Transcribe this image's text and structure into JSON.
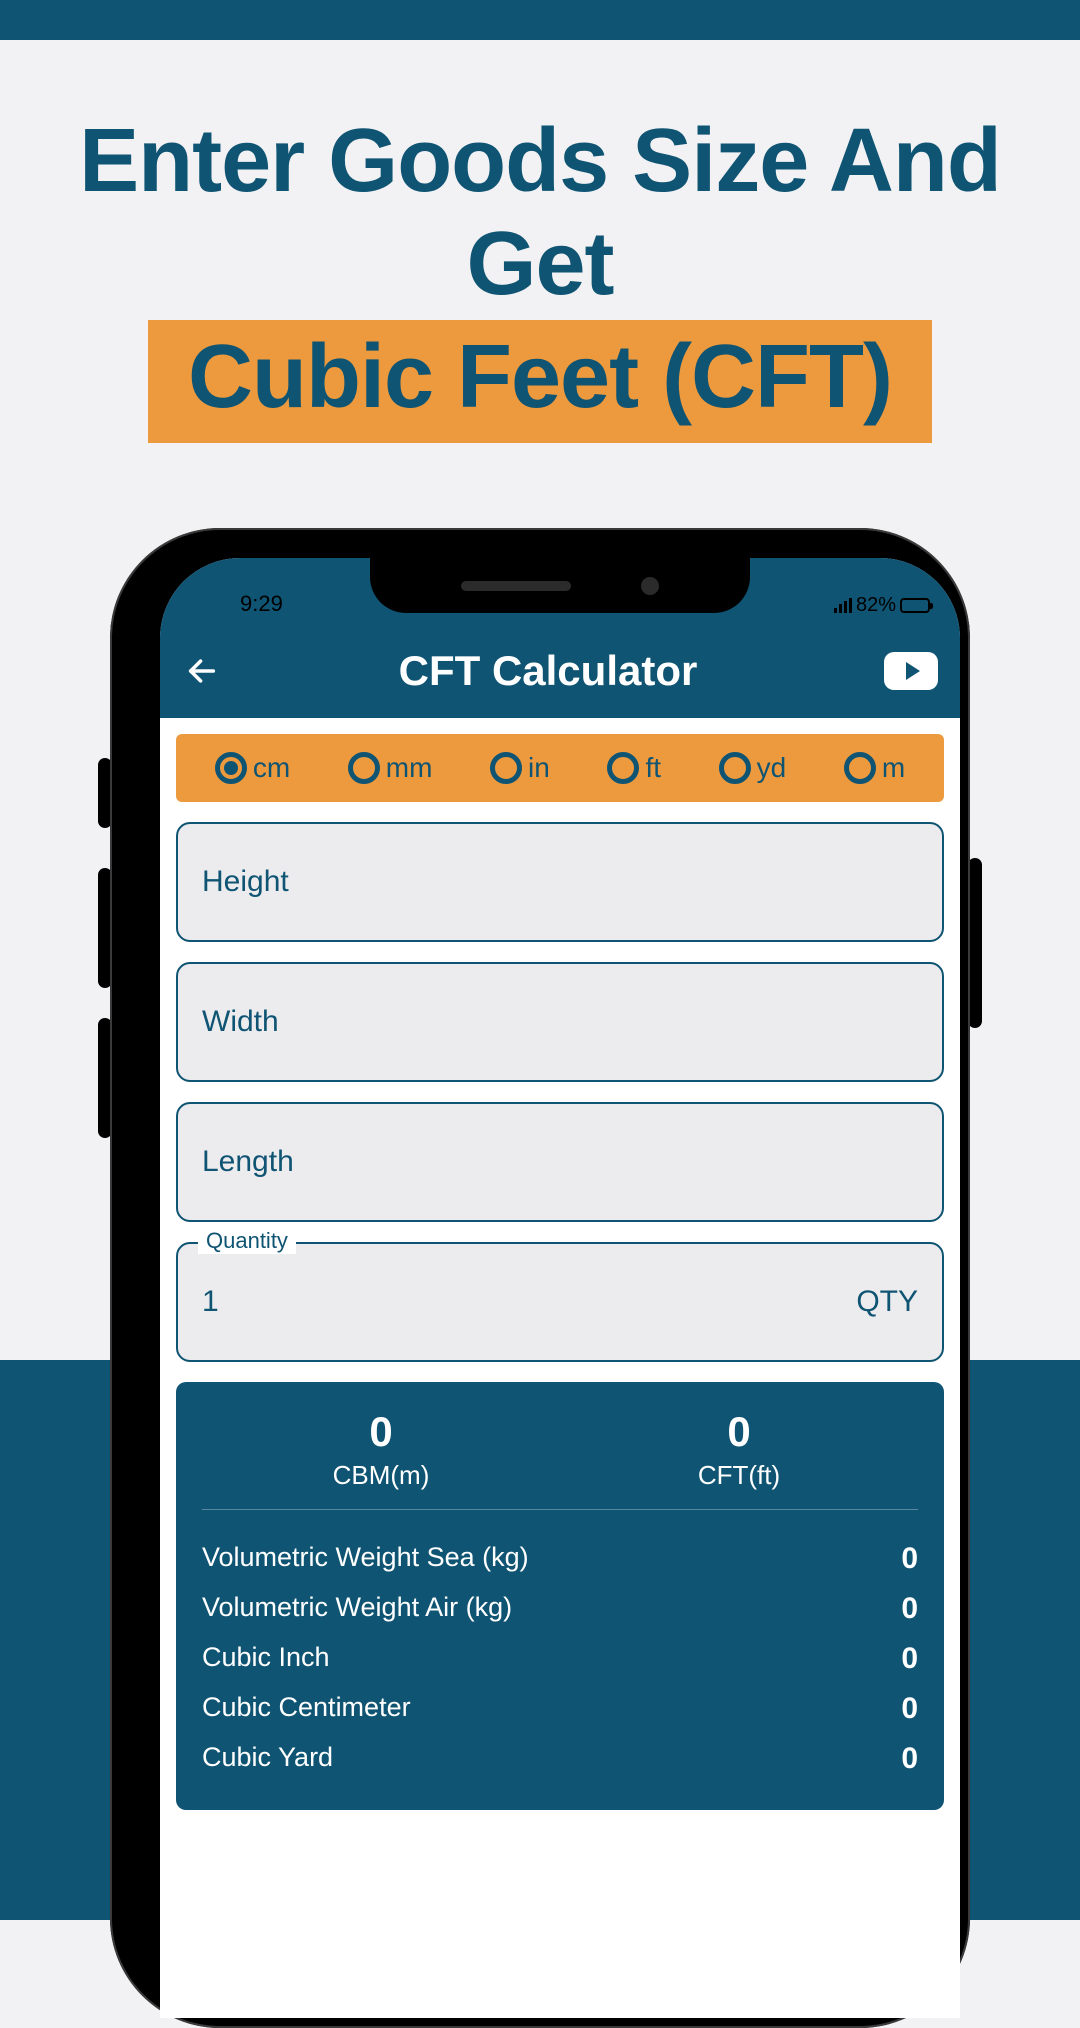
{
  "headline": {
    "line1": "Enter Goods Size And Get",
    "line2": "Cubic Feet (CFT)"
  },
  "status": {
    "time": "9:29",
    "battery_pct": "82%"
  },
  "app": {
    "title": "CFT Calculator"
  },
  "units": [
    {
      "label": "cm",
      "selected": true
    },
    {
      "label": "mm",
      "selected": false
    },
    {
      "label": "in",
      "selected": false
    },
    {
      "label": "ft",
      "selected": false
    },
    {
      "label": "yd",
      "selected": false
    },
    {
      "label": "m",
      "selected": false
    }
  ],
  "fields": {
    "height_placeholder": "Height",
    "width_placeholder": "Width",
    "length_placeholder": "Length",
    "quantity_legend": "Quantity",
    "quantity_value": "1",
    "quantity_suffix": "QTY"
  },
  "results": {
    "cbm_value": "0",
    "cbm_label": "CBM(m)",
    "cft_value": "0",
    "cft_label": "CFT(ft)",
    "rows": [
      {
        "label": "Volumetric Weight Sea (kg)",
        "value": "0"
      },
      {
        "label": "Volumetric Weight Air (kg)",
        "value": "0"
      },
      {
        "label": "Cubic Inch",
        "value": "0"
      },
      {
        "label": "Cubic Centimeter",
        "value": "0"
      },
      {
        "label": "Cubic Yard",
        "value": "0"
      }
    ]
  }
}
